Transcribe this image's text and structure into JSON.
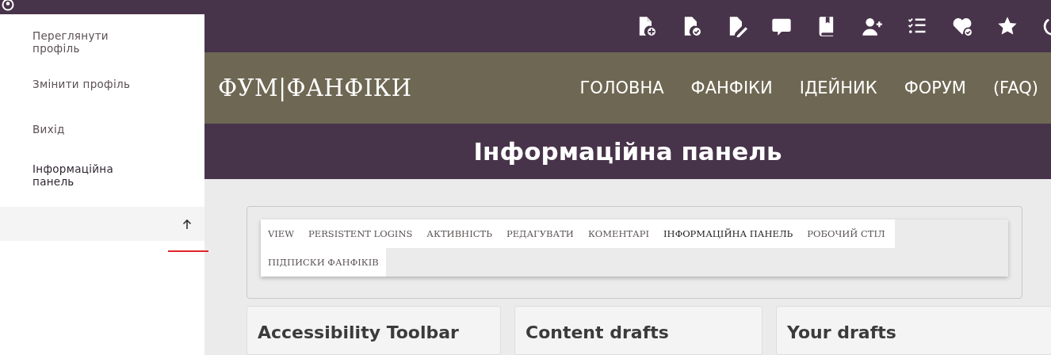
{
  "sidebar": {
    "items": [
      {
        "label": "Переглянути профіль",
        "selected": false
      },
      {
        "label": "Змінити профіль",
        "selected": false
      },
      {
        "label": "Вихід",
        "selected": false
      },
      {
        "label": "Інформаційна панель",
        "selected": true
      }
    ]
  },
  "header": {
    "site_title": "ФУМ|ФАНФІКИ",
    "nav": [
      "ГОЛОВНА",
      "ФАНФІКИ",
      "ІДЕЙНИК",
      "ФОРУМ",
      "(FAQ)"
    ]
  },
  "page_title": "Інформаційна панель",
  "tabs": [
    {
      "label": "VIEW",
      "selected": false
    },
    {
      "label": "PERSISTENT LOGINS",
      "selected": false
    },
    {
      "label": "АКТИВНІСТЬ",
      "selected": false
    },
    {
      "label": "РЕДАГУВАТИ",
      "selected": false
    },
    {
      "label": "КОМЕНТАРІ",
      "selected": false
    },
    {
      "label": "ІНФОРМАЦІЙНА ПАНЕЛЬ",
      "selected": true
    },
    {
      "label": "РОБОЧИЙ СТІЛ",
      "selected": false
    },
    {
      "label": "ПІДПИСКИ ФАНФІКІВ",
      "selected": false
    }
  ],
  "cards": [
    {
      "title": "Accessibility Toolbar"
    },
    {
      "title": "Content drafts"
    },
    {
      "title": "Your drafts"
    }
  ]
}
